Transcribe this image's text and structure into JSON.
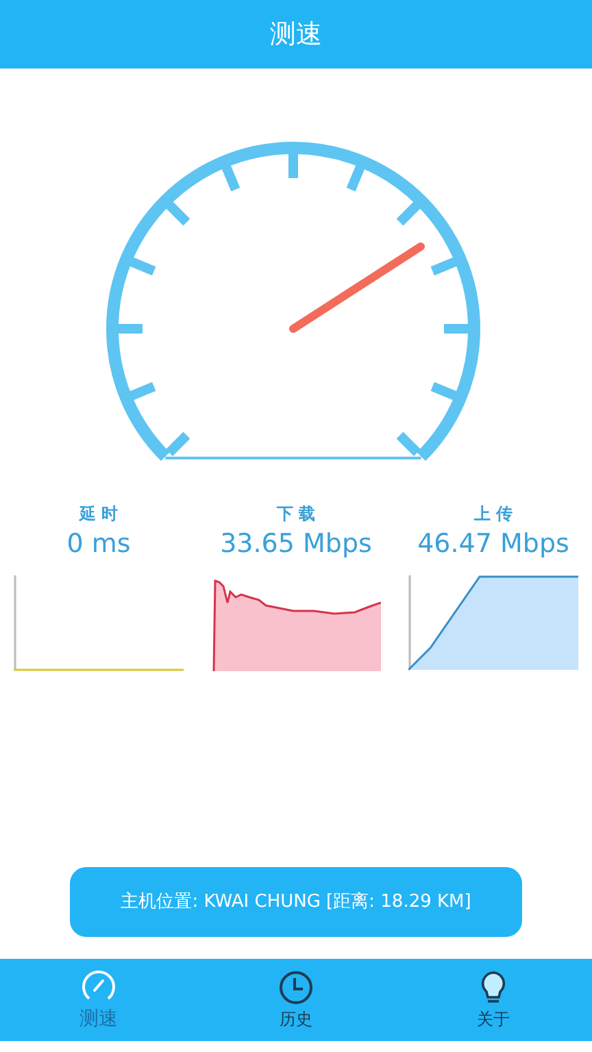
{
  "header": {
    "title": "测速"
  },
  "stats": [
    {
      "kind": "latency",
      "label": "延 时",
      "value": "0 ms"
    },
    {
      "kind": "download",
      "label": "下 载",
      "value": "33.65 Mbps"
    },
    {
      "kind": "upload",
      "label": "上 传",
      "value": "46.47 Mbps"
    }
  ],
  "server": {
    "text": "主机位置: KWAI CHUNG [距离: 18.29 KM]"
  },
  "nav": [
    {
      "kind": "speed",
      "label": "测速",
      "selected": true
    },
    {
      "kind": "history",
      "label": "历史",
      "selected": false
    },
    {
      "kind": "about",
      "label": "关于",
      "selected": false
    }
  ]
}
